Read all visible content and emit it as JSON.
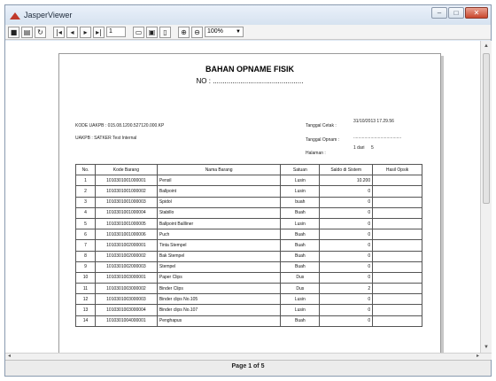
{
  "window": {
    "title": "JasperViewer",
    "controls": {
      "minimize": "‒",
      "maximize": "□",
      "close": "✕"
    }
  },
  "toolbar": {
    "page_value": "1",
    "zoom_value": "100%"
  },
  "report": {
    "title": "BAHAN OPNAME FISIK",
    "no_line": "NO : ..............................................",
    "kode_uakpb": "KODE UAKPB : 015.08.1200.527120.000.KP",
    "uakpb": "UAKPB : SATKER Test Internal",
    "tanggal_cetak_label": "Tanggal Cetak :",
    "tanggal_cetak_value": "31/10/2013 17.29.56",
    "tanggal_opnam_label": "Tanggal Opnam :",
    "tanggal_opnam_value": ".......................................",
    "halaman_label": "Halaman :",
    "halaman_value": "1 dari",
    "halaman_total": "5"
  },
  "table": {
    "headers": [
      "No.",
      "Kode Barang",
      "Nama Barang",
      "Satuan",
      "Saldo di Sistem",
      "Hasil Opsik"
    ],
    "rows": [
      [
        "1",
        "1010301001000001",
        "Pensil",
        "Lusin",
        "10.200",
        ""
      ],
      [
        "2",
        "1010301001000002",
        "Ballpoint",
        "Lusin",
        "0",
        ""
      ],
      [
        "3",
        "1010301001000003",
        "Spidol",
        "buah",
        "0",
        ""
      ],
      [
        "4",
        "1010301001000004",
        "Stabillo",
        "Buah",
        "0",
        ""
      ],
      [
        "5",
        "1010301001000005",
        "Ballpoint Ballliner",
        "Lusin",
        "0",
        ""
      ],
      [
        "6",
        "1010301001000006",
        "Puch",
        "Buah",
        "0",
        ""
      ],
      [
        "7",
        "1010301002000001",
        "Tinta Stempel",
        "Buah",
        "0",
        ""
      ],
      [
        "8",
        "1010301002000002",
        "Bak Stempel",
        "Buah",
        "0",
        ""
      ],
      [
        "9",
        "1010301002000003",
        "Stempel",
        "Buah",
        "0",
        ""
      ],
      [
        "10",
        "1010301003000001",
        "Paper Clips",
        "Dus",
        "0",
        ""
      ],
      [
        "11",
        "1010301003000002",
        "Binder Clips",
        "Dus",
        "2",
        ""
      ],
      [
        "12",
        "1010301003000003",
        "Binder clips No.105",
        "Lusin",
        "0",
        ""
      ],
      [
        "13",
        "1010301003000004",
        "Binder clips No.107",
        "Lusin",
        "0",
        ""
      ],
      [
        "14",
        "1010301004000001",
        "Penghapus",
        "Buah",
        "0",
        ""
      ]
    ]
  },
  "status": {
    "page_info": "Page 1 of 5"
  }
}
